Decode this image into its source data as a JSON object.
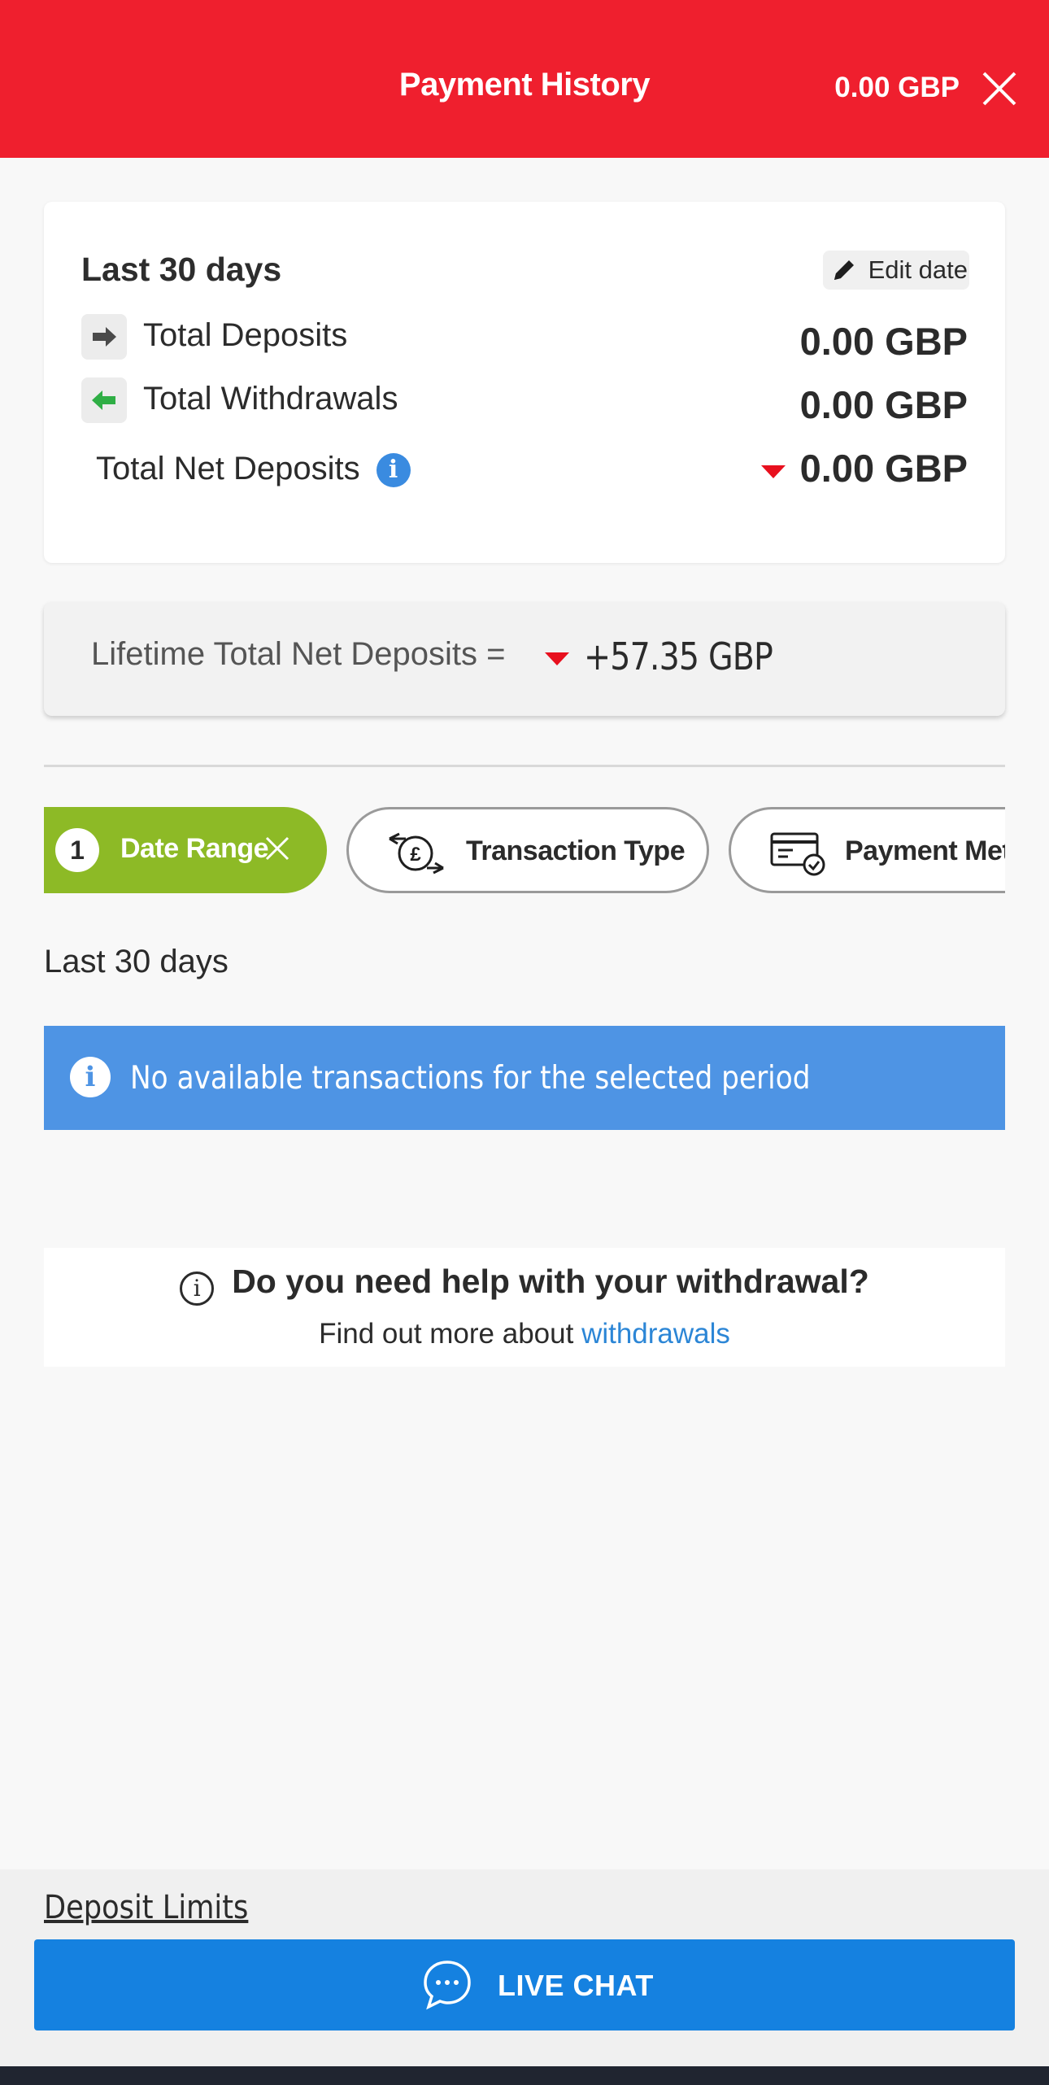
{
  "header": {
    "title": "Payment History",
    "balance": "0.00 GBP"
  },
  "summary": {
    "period": "Last 30 days",
    "edit_date_label": "Edit date",
    "rows": [
      {
        "label": "Total Deposits",
        "value": "0.00 GBP",
        "icon": "arrow-right-icon"
      },
      {
        "label": "Total Withdrawals",
        "value": "0.00 GBP",
        "icon": "arrow-left-icon"
      },
      {
        "label": "Total Net Deposits",
        "value": "0.00 GBP",
        "icon": "info-icon"
      }
    ]
  },
  "lifetime": {
    "label": "Lifetime Total Net Deposits =",
    "value": "+57.35 GBP"
  },
  "filters": {
    "date_range": {
      "count": "1",
      "label": "Date Range"
    },
    "transaction_type": {
      "label": "Transaction Type"
    },
    "payment_method": {
      "label": "Payment Method"
    }
  },
  "period_label": "Last 30 days",
  "info_banner": "No available transactions for the selected period",
  "help": {
    "title": "Do you need help with your withdrawal?",
    "text": "Find out more about",
    "link": "withdrawals"
  },
  "footer": {
    "deposit_limits": "Deposit Limits",
    "live_chat": "LIVE CHAT"
  },
  "colors": {
    "header": "#ef1f2e",
    "chip_active": "#8dba26",
    "banner": "#4e94e4",
    "live_chat": "#1581e0",
    "negative": "#e8101e"
  }
}
